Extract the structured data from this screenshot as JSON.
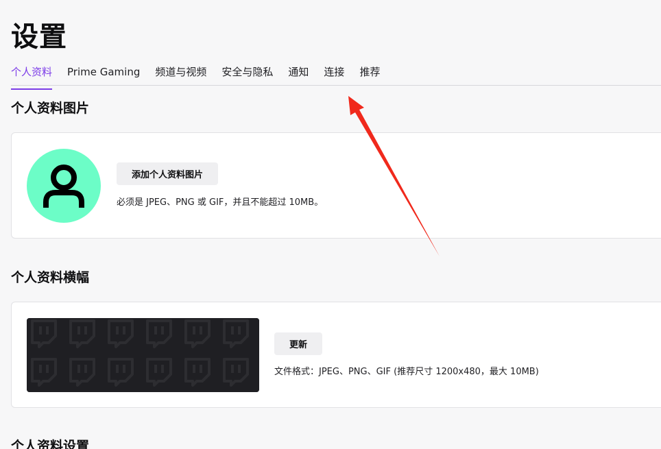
{
  "page": {
    "title": "设置"
  },
  "tabs": [
    {
      "label": "个人资料",
      "active": true
    },
    {
      "label": "Prime Gaming",
      "active": false
    },
    {
      "label": "频道与视频",
      "active": false
    },
    {
      "label": "安全与隐私",
      "active": false
    },
    {
      "label": "通知",
      "active": false
    },
    {
      "label": "连接",
      "active": false
    },
    {
      "label": "推荐",
      "active": false
    }
  ],
  "profile_picture": {
    "title": "个人资料图片",
    "add_button_label": "添加个人资料图片",
    "hint": "必须是 JPEG、PNG 或 GIF，并且不能超过 10MB。",
    "avatar_color": "#6cfdc7",
    "avatar_icon": "user-icon"
  },
  "profile_banner": {
    "title": "个人资料横幅",
    "update_button_label": "更新",
    "hint": "文件格式：JPEG、PNG、GIF (推荐尺寸 1200x480，最大 10MB)",
    "pattern_icon": "twitch-glitch-icon"
  },
  "profile_settings": {
    "title": "个人资料设置"
  },
  "colors": {
    "accent": "#7c3ce8",
    "annotation_arrow": "#f0291c"
  }
}
